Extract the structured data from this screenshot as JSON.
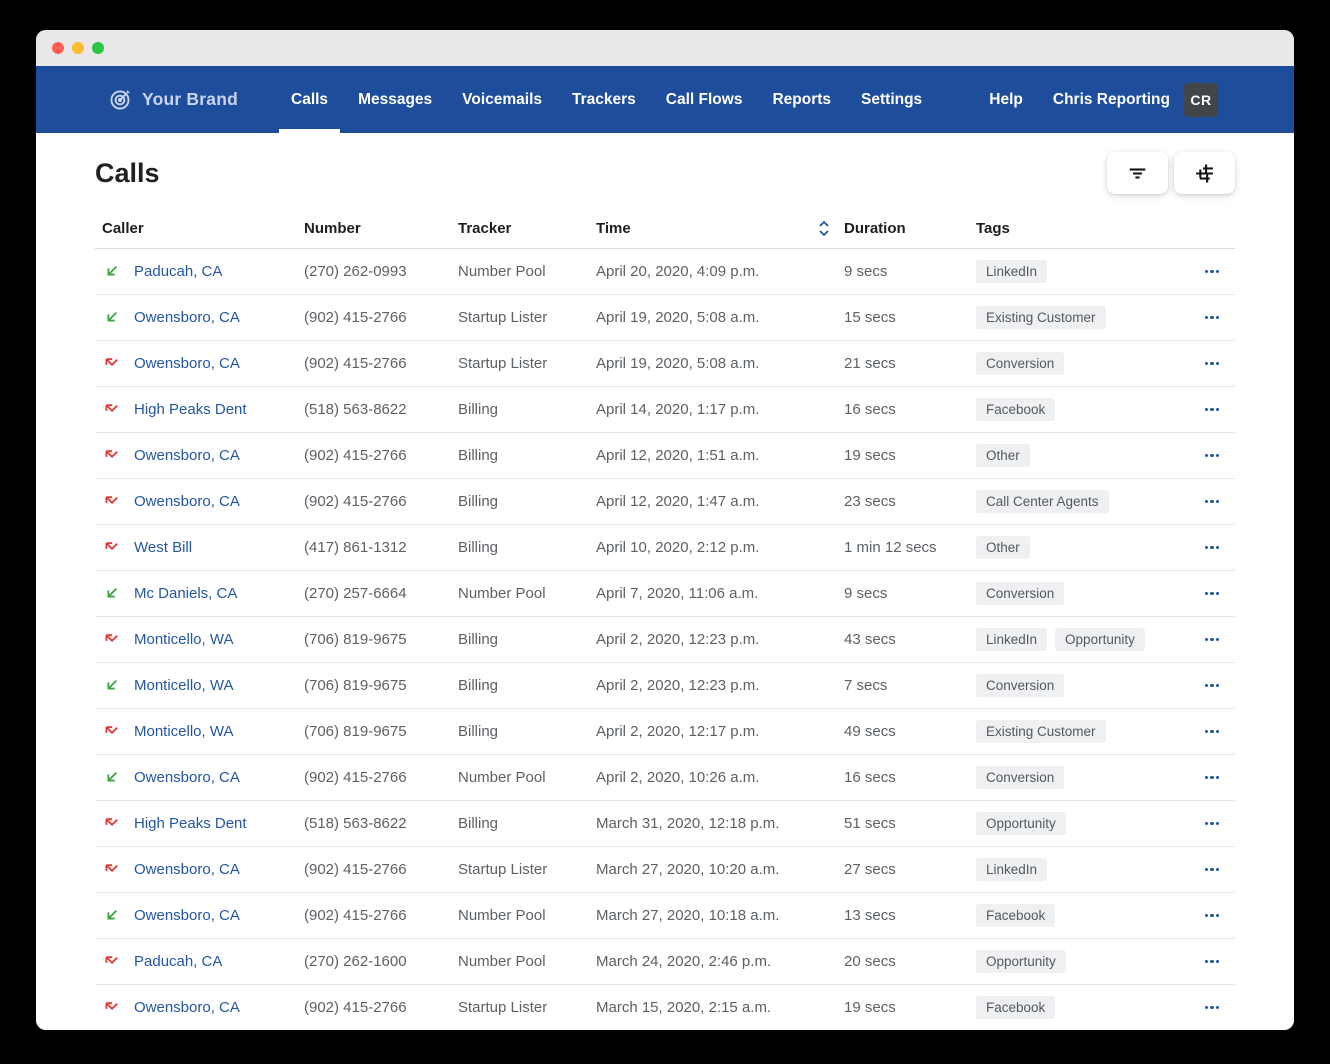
{
  "nav": {
    "brand": "Your Brand",
    "tabs": [
      {
        "label": "Calls",
        "active": true
      },
      {
        "label": "Messages",
        "active": false
      },
      {
        "label": "Voicemails",
        "active": false
      },
      {
        "label": "Trackers",
        "active": false
      },
      {
        "label": "Call Flows",
        "active": false
      },
      {
        "label": "Reports",
        "active": false
      },
      {
        "label": "Settings",
        "active": false
      }
    ],
    "help_label": "Help",
    "user_name": "Chris Reporting",
    "avatar_initials": "CR"
  },
  "page": {
    "title": "Calls"
  },
  "toolbar": {
    "icons": [
      "filter-icon",
      "sliders-icon"
    ]
  },
  "table": {
    "columns": [
      "Caller",
      "Number",
      "Tracker",
      "Time",
      "Duration",
      "Tags"
    ],
    "sorted_column": "Time",
    "rows": [
      {
        "direction": "inbound",
        "caller": "Paducah, CA",
        "number": "(270) 262-0993",
        "tracker": "Number Pool",
        "time": "April 20, 2020, 4:09 p.m.",
        "duration": "9 secs",
        "tags": [
          "LinkedIn"
        ]
      },
      {
        "direction": "inbound",
        "caller": "Owensboro, CA",
        "number": "(902) 415-2766",
        "tracker": "Startup Lister",
        "time": "April 19, 2020, 5:08 a.m.",
        "duration": "15 secs",
        "tags": [
          "Existing Customer"
        ]
      },
      {
        "direction": "missed",
        "caller": "Owensboro, CA",
        "number": "(902) 415-2766",
        "tracker": "Startup Lister",
        "time": "April 19, 2020, 5:08 a.m.",
        "duration": "21 secs",
        "tags": [
          "Conversion"
        ]
      },
      {
        "direction": "missed",
        "caller": "High Peaks Dent",
        "number": "(518) 563-8622",
        "tracker": "Billing",
        "time": "April 14, 2020, 1:17 p.m.",
        "duration": "16 secs",
        "tags": [
          "Facebook"
        ]
      },
      {
        "direction": "missed",
        "caller": "Owensboro, CA",
        "number": "(902) 415-2766",
        "tracker": "Billing",
        "time": "April 12, 2020, 1:51 a.m.",
        "duration": "19 secs",
        "tags": [
          "Other"
        ]
      },
      {
        "direction": "missed",
        "caller": "Owensboro, CA",
        "number": "(902) 415-2766",
        "tracker": "Billing",
        "time": "April 12, 2020, 1:47 a.m.",
        "duration": "23 secs",
        "tags": [
          "Call Center Agents"
        ]
      },
      {
        "direction": "missed",
        "caller": "West Bill",
        "number": "(417) 861-1312",
        "tracker": "Billing",
        "time": "April 10, 2020, 2:12 p.m.",
        "duration": "1 min 12 secs",
        "tags": [
          "Other"
        ]
      },
      {
        "direction": "inbound",
        "caller": "Mc Daniels, CA",
        "number": "(270) 257-6664",
        "tracker": "Number Pool",
        "time": "April 7, 2020, 11:06 a.m.",
        "duration": "9 secs",
        "tags": [
          "Conversion"
        ]
      },
      {
        "direction": "missed",
        "caller": "Monticello, WA",
        "number": "(706) 819-9675",
        "tracker": "Billing",
        "time": "April 2, 2020, 12:23 p.m.",
        "duration": "43 secs",
        "tags": [
          "LinkedIn",
          "Opportunity"
        ]
      },
      {
        "direction": "inbound",
        "caller": "Monticello, WA",
        "number": "(706) 819-9675",
        "tracker": "Billing",
        "time": "April 2, 2020, 12:23 p.m.",
        "duration": "7 secs",
        "tags": [
          "Conversion"
        ]
      },
      {
        "direction": "missed",
        "caller": "Monticello, WA",
        "number": "(706) 819-9675",
        "tracker": "Billing",
        "time": "April 2, 2020, 12:17 p.m.",
        "duration": "49 secs",
        "tags": [
          "Existing Customer"
        ]
      },
      {
        "direction": "inbound",
        "caller": "Owensboro, CA",
        "number": "(902) 415-2766",
        "tracker": "Number Pool",
        "time": "April 2, 2020, 10:26 a.m.",
        "duration": "16 secs",
        "tags": [
          "Conversion"
        ]
      },
      {
        "direction": "missed",
        "caller": "High Peaks Dent",
        "number": "(518) 563-8622",
        "tracker": "Billing",
        "time": "March 31, 2020, 12:18 p.m.",
        "duration": "51 secs",
        "tags": [
          "Opportunity"
        ]
      },
      {
        "direction": "missed",
        "caller": "Owensboro, CA",
        "number": "(902) 415-2766",
        "tracker": "Startup Lister",
        "time": "March 27, 2020, 10:20 a.m.",
        "duration": "27 secs",
        "tags": [
          "LinkedIn"
        ]
      },
      {
        "direction": "inbound",
        "caller": "Owensboro, CA",
        "number": "(902) 415-2766",
        "tracker": "Number Pool",
        "time": "March 27, 2020, 10:18 a.m.",
        "duration": "13 secs",
        "tags": [
          "Facebook"
        ]
      },
      {
        "direction": "missed",
        "caller": "Paducah, CA",
        "number": "(270) 262-1600",
        "tracker": "Number Pool",
        "time": "March 24, 2020, 2:46 p.m.",
        "duration": "20 secs",
        "tags": [
          "Opportunity"
        ]
      },
      {
        "direction": "missed",
        "caller": "Owensboro, CA",
        "number": "(902) 415-2766",
        "tracker": "Startup Lister",
        "time": "March 15, 2020, 2:15 a.m.",
        "duration": "19 secs",
        "tags": [
          "Facebook"
        ]
      }
    ]
  },
  "colors": {
    "nav_blue": "#1e4d9c",
    "link_blue": "#2456a4",
    "inbound_green": "#3ba440",
    "missed_red": "#df3a34",
    "tag_bg": "#eff0f1",
    "avatar_bg": "#42464b"
  }
}
